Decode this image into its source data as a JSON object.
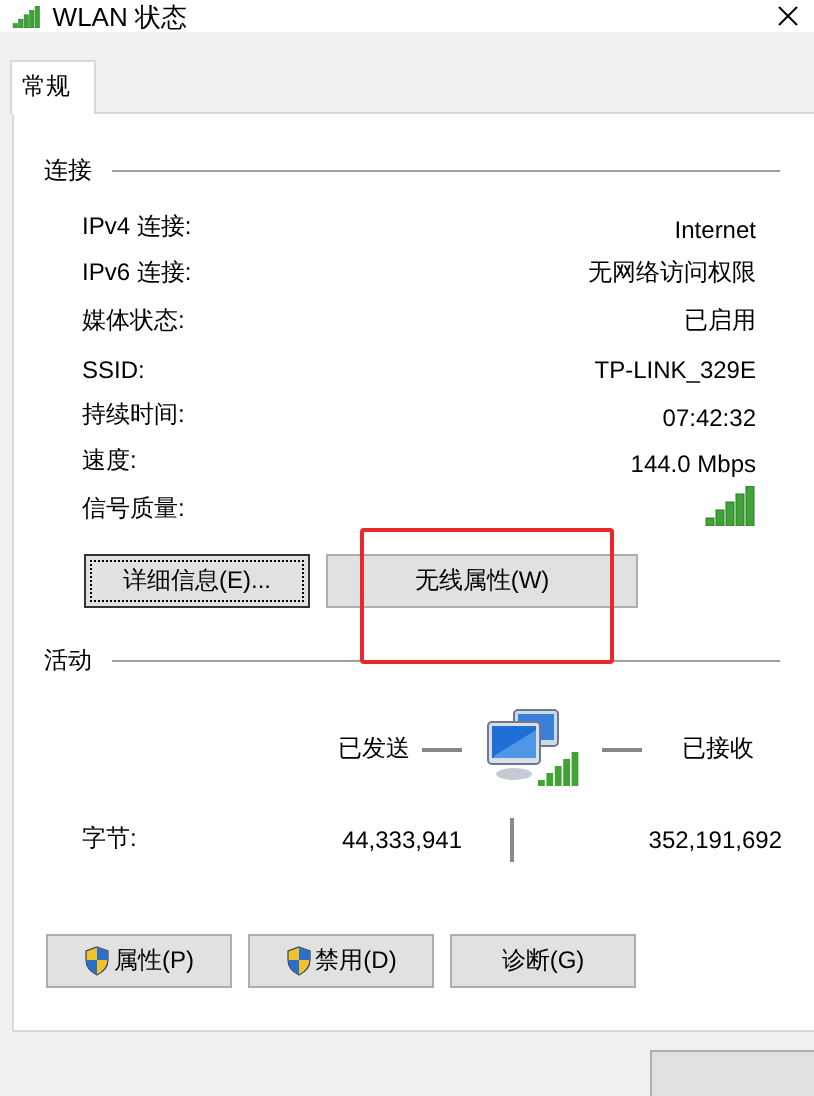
{
  "window": {
    "title": "WLAN 状态"
  },
  "tabs": [
    {
      "label": "常规",
      "selected": true
    }
  ],
  "connection": {
    "heading": "连接",
    "rows": [
      {
        "label": "IPv4 连接:",
        "value": "Internet",
        "kind": "text"
      },
      {
        "label": "IPv6 连接:",
        "value": "无网络访问权限",
        "kind": "text"
      },
      {
        "label": "媒体状态:",
        "value": "已启用",
        "kind": "text"
      },
      {
        "label": "SSID:",
        "value": "TP-LINK_329E",
        "kind": "text"
      },
      {
        "label": "持续时间:",
        "value": "07:42:32",
        "kind": "text"
      },
      {
        "label": "速度:",
        "value": "144.0 Mbps",
        "kind": "text"
      },
      {
        "label": "信号质量:",
        "kind": "signal"
      }
    ],
    "buttons": [
      {
        "label": "详细信息(E)...",
        "focused": true
      },
      {
        "label": "无线属性(W)",
        "focused": false
      }
    ]
  },
  "activity": {
    "heading": "活动",
    "sent_label": "已发送",
    "received_label": "已接收",
    "bytes_label": "字节:",
    "bytes_sent": "44,333,941",
    "bytes_received": "352,191,692"
  },
  "bottom_buttons": [
    {
      "label": "属性(P)",
      "shield": true
    },
    {
      "label": "禁用(D)",
      "shield": true
    },
    {
      "label": "诊断(G)",
      "shield": false
    }
  ]
}
